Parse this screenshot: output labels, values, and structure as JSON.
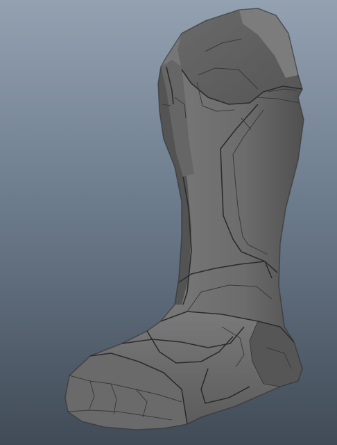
{
  "scene": {
    "background_top": "#93a1b1",
    "background_bottom": "#414b57",
    "model_color": "#6f6f6f",
    "model_shadow_color": "#4f4f4f",
    "model_highlight_color": "#8a8a8a",
    "edge_color": "#2c2c2c"
  }
}
